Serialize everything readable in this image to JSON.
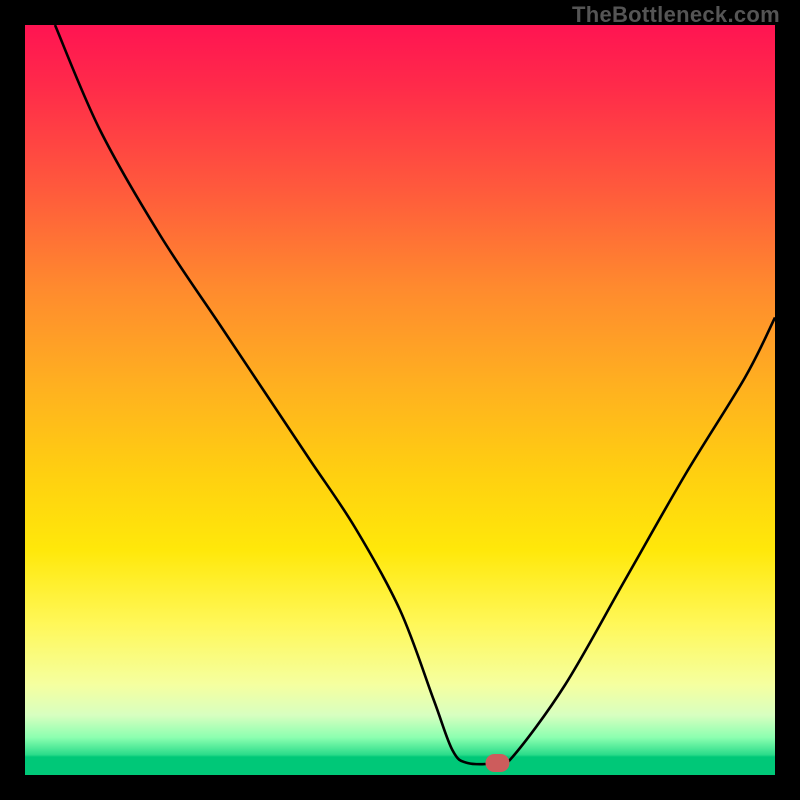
{
  "watermark": "TheBottleneck.com",
  "colors": {
    "frame": "#000000",
    "curve": "#000000",
    "marker": "#cd5c5c",
    "gradient_top": "#ff1452",
    "gradient_bottom": "#00c878"
  },
  "chart_data": {
    "type": "line",
    "title": "",
    "xlabel": "",
    "ylabel": "",
    "xlim": [
      0,
      100
    ],
    "ylim": [
      0,
      100
    ],
    "grid": false,
    "series": [
      {
        "name": "bottleneck-curve",
        "x": [
          4,
          10,
          18,
          26,
          32,
          38,
          44,
          50,
          54.5,
          57,
          59,
          63,
          65,
          72,
          80,
          88,
          96,
          100
        ],
        "values": [
          100,
          86,
          72,
          60,
          51,
          42,
          33,
          22,
          10,
          3.3,
          1.6,
          1.6,
          2.4,
          12,
          26,
          40,
          53,
          61
        ]
      }
    ],
    "annotations": [
      {
        "name": "minimum-marker",
        "x": 63,
        "y": 1.6
      }
    ]
  }
}
